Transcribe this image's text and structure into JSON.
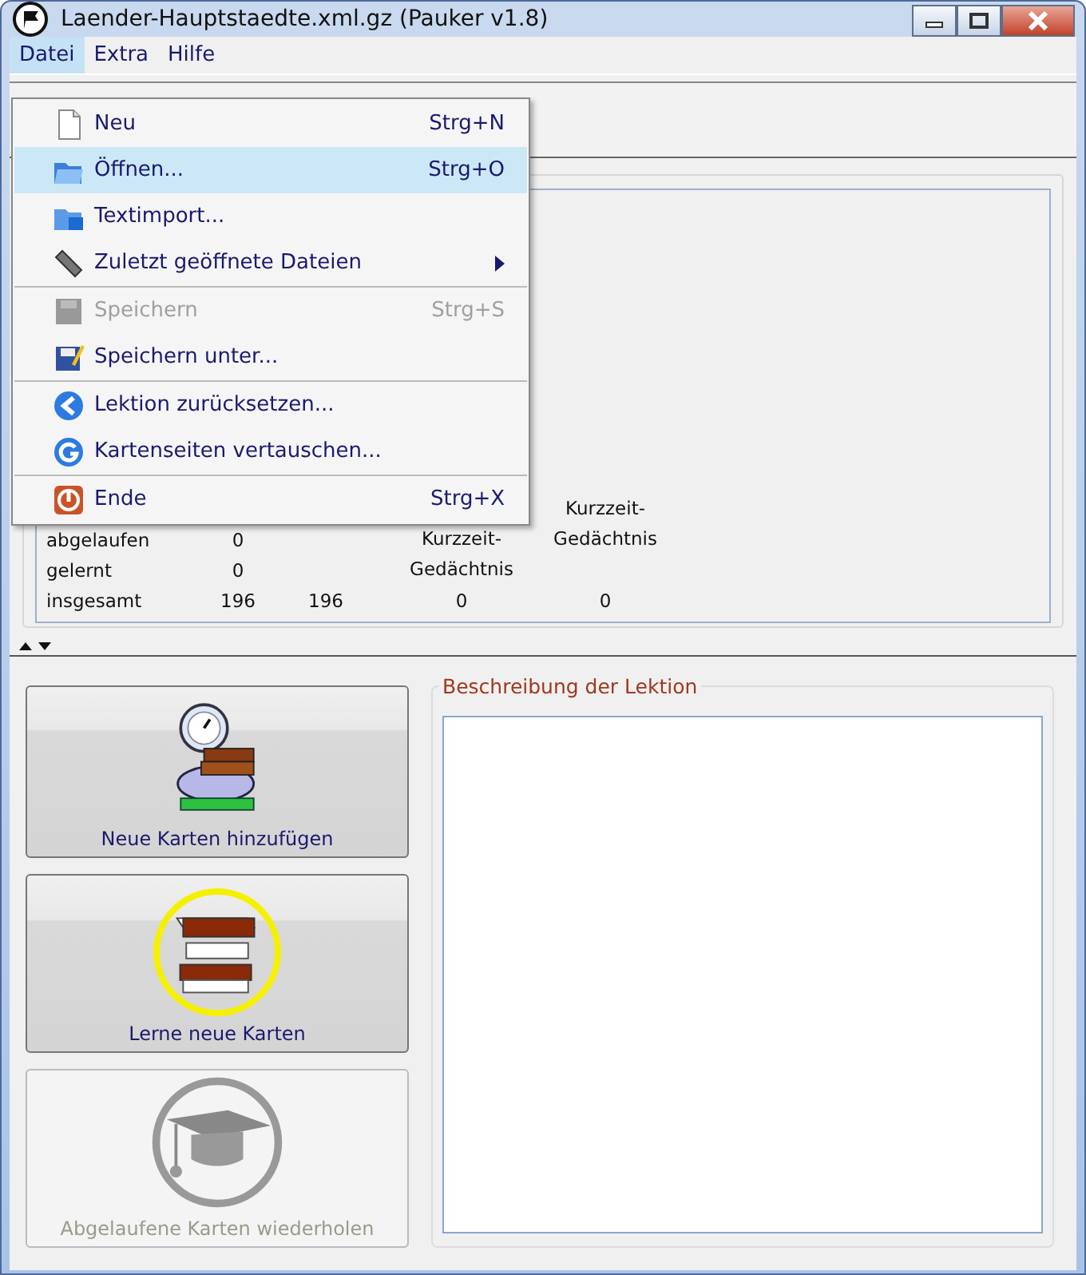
{
  "window": {
    "title": "Laender-Hauptstaedte.xml.gz (Pauker v1.8)"
  },
  "menubar": [
    {
      "label": "Datei",
      "selected": true
    },
    {
      "label": "Extra",
      "selected": false
    },
    {
      "label": "Hilfe",
      "selected": false
    }
  ],
  "file_menu": {
    "groups": [
      [
        {
          "label": "Neu",
          "shortcut": "Strg+N",
          "selected": false,
          "disabled": false,
          "submenu": false
        },
        {
          "label": "Öffnen...",
          "shortcut": "Strg+O",
          "selected": true,
          "disabled": false,
          "submenu": false
        },
        {
          "label": "Textimport...",
          "selected": false,
          "disabled": false,
          "submenu": false
        },
        {
          "label": "Zuletzt geöffnete Dateien",
          "selected": false,
          "disabled": false,
          "submenu": true
        }
      ],
      [
        {
          "label": "Speichern",
          "shortcut": "Strg+S",
          "selected": false,
          "disabled": true,
          "submenu": false
        },
        {
          "label": "Speichern unter...",
          "selected": false,
          "disabled": false,
          "submenu": false
        }
      ],
      [
        {
          "label": "Lektion zurücksetzen...",
          "selected": false,
          "disabled": false,
          "submenu": false
        },
        {
          "label": "Kartenseiten vertauschen...",
          "selected": false,
          "disabled": false,
          "submenu": false
        }
      ],
      [
        {
          "label": "Ende",
          "shortcut": "Strg+X",
          "selected": false,
          "disabled": false,
          "submenu": false
        }
      ]
    ]
  },
  "statistics": {
    "column_3_header": [
      "Kurzzeit-",
      "Gedächtnis"
    ],
    "column_4_header": [
      "Kurzzeit-",
      "Gedächtnis"
    ],
    "rows": [
      {
        "label": "abgelaufen",
        "cells": [
          "0"
        ]
      },
      {
        "label": "gelernt",
        "cells": [
          "0"
        ]
      },
      {
        "label": "insgesamt",
        "cells": [
          "196",
          "196",
          "0",
          "0"
        ]
      }
    ]
  },
  "actions": [
    {
      "label": "Neue Karten hinzufügen",
      "disabled": false,
      "highlighted": false
    },
    {
      "label": "Lerne neue Karten",
      "disabled": false,
      "highlighted": true
    },
    {
      "label": "Abgelaufene Karten wiederholen",
      "disabled": true,
      "highlighted": false
    }
  ],
  "description": {
    "title": "Beschreibung der Lektion"
  }
}
